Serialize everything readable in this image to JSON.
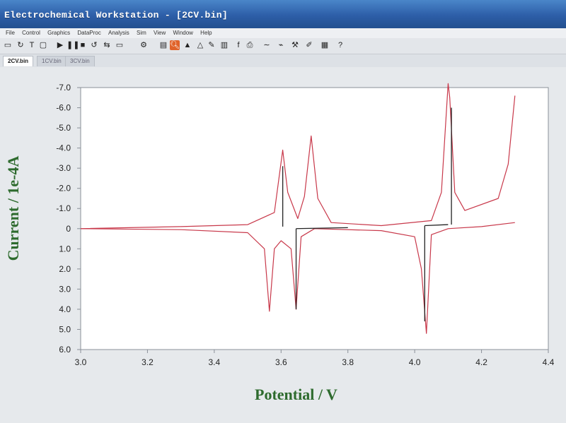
{
  "window": {
    "title": "Electrochemical Workstation - [2CV.bin]"
  },
  "menu": [
    "File",
    "Control",
    "Graphics",
    "DataProc",
    "Analysis",
    "Sim",
    "View",
    "Window",
    "Help"
  ],
  "tabs": [
    {
      "label": "2CV.bin",
      "active": true
    },
    {
      "label": "1CV.bin",
      "active": false
    },
    {
      "label": "3CV.bin",
      "active": false
    }
  ],
  "colors": {
    "curve": "#c8384a",
    "baseline": "#222222",
    "axis_label": "#2e6b2e"
  },
  "chart_data": {
    "type": "line",
    "xlabel": "Potential / V",
    "ylabel": "Current / 1e-4A",
    "xlim": [
      3.0,
      4.4
    ],
    "ylim": [
      6.0,
      -7.0
    ],
    "y_inverted": true,
    "x_ticks": [
      "3.0",
      "3.2",
      "3.4",
      "3.6",
      "3.8",
      "4.0",
      "4.2",
      "4.4"
    ],
    "y_ticks": [
      "-7.0",
      "-6.0",
      "-5.0",
      "-4.0",
      "-3.0",
      "-2.0",
      "-1.0",
      "0",
      "1.0",
      "2.0",
      "3.0",
      "4.0",
      "5.0",
      "6.0"
    ],
    "grid": false,
    "series": [
      {
        "x": [
          3.0,
          3.3,
          3.5,
          3.58,
          3.605,
          3.62,
          3.65,
          3.67,
          3.69,
          3.71,
          3.75,
          3.9,
          4.05,
          4.08,
          4.1,
          4.105,
          4.12,
          4.15,
          4.25,
          4.28,
          4.3
        ],
        "y": [
          0.0,
          -0.1,
          -0.2,
          -0.8,
          -3.9,
          -1.8,
          -0.5,
          -1.6,
          -4.6,
          -1.5,
          -0.3,
          -0.15,
          -0.4,
          -1.8,
          -7.2,
          -6.5,
          -1.8,
          -0.9,
          -1.5,
          -3.2,
          -6.6
        ]
      },
      {
        "x": [
          4.3,
          4.2,
          4.1,
          4.05,
          4.035,
          4.02,
          4.0,
          3.9,
          3.7,
          3.66,
          3.645,
          3.63,
          3.6,
          3.58,
          3.565,
          3.55,
          3.5,
          3.3,
          3.0
        ],
        "y": [
          -0.3,
          -0.1,
          0.0,
          0.3,
          5.2,
          2.0,
          0.4,
          0.1,
          0.0,
          0.4,
          4.0,
          1.0,
          0.6,
          1.0,
          4.1,
          1.0,
          0.2,
          0.05,
          0.0
        ]
      }
    ]
  }
}
